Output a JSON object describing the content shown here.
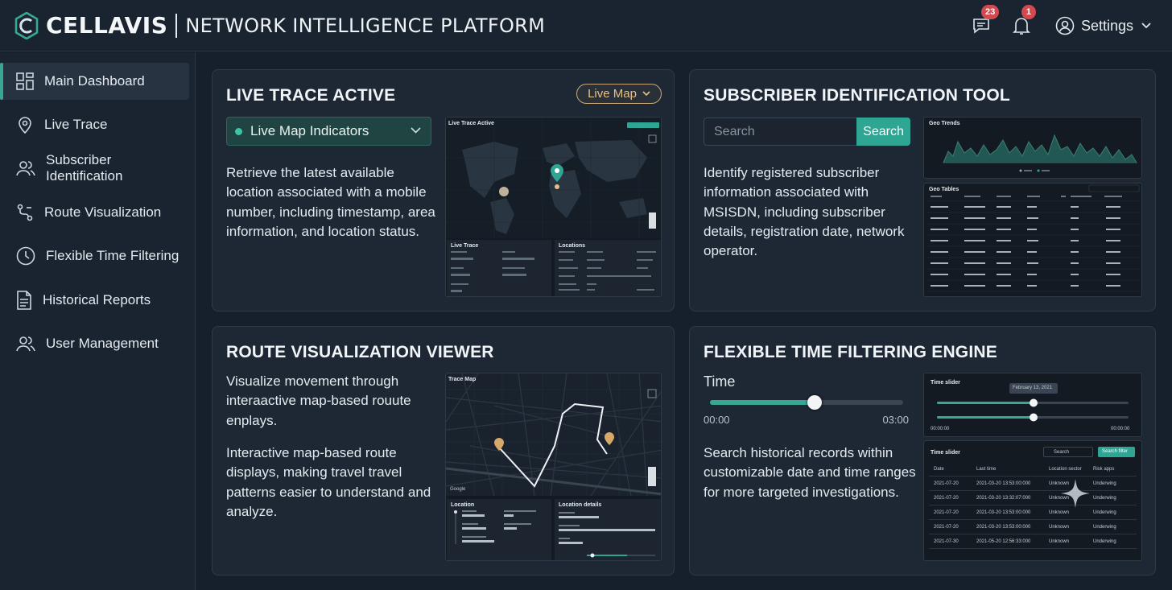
{
  "brand": {
    "name": "CELLAVIS",
    "subtitle": "NETWORK INTELLIGENCE PLATFORM"
  },
  "header": {
    "messages_count": "23",
    "alerts_count": "1",
    "settings_label": "Settings"
  },
  "sidebar": {
    "items": [
      {
        "label": "Main Dashboard",
        "icon": "grid-icon",
        "active": true
      },
      {
        "label": "Live Trace",
        "icon": "location-pin-icon"
      },
      {
        "label": "Subscriber Identification",
        "icon": "users-icon"
      },
      {
        "label": "Route Visualization",
        "icon": "route-icon"
      },
      {
        "label": "Flexible Time Filtering",
        "icon": "clock-icon"
      },
      {
        "label": "Historical Reports",
        "icon": "document-icon"
      },
      {
        "label": "User Management",
        "icon": "users-icon"
      }
    ]
  },
  "live_trace": {
    "title": "LIVE TRACE ACTIVE",
    "pill": "Live Map",
    "dropdown": "Live Map Indicators",
    "description": "Retrieve the latest available location associated with a mobile number, including timestamp, area information, and location status.",
    "preview": {
      "title": "Live Trace Active",
      "panel_left": "Live Trace",
      "panel_right": "Locations"
    }
  },
  "subscriber": {
    "title": "SUBSCRIBER IDENTIFICATION TOOL",
    "search_placeholder": "Search",
    "search_button": "Search",
    "description": "Identify registered subscriber information associated with MSISDN, including subscriber details, registration date, network operator.",
    "preview": {
      "chart_title": "Geo Trends",
      "table_title": "Geo Tables"
    }
  },
  "route": {
    "title": "ROUTE VISUALIZATION VIEWER",
    "description1": "Visualize movement through interaactive map-based rouute enplays.",
    "description2": "Interactive map-based route displays, making travel travel patterns easier to understand and analyze.",
    "preview": {
      "title": "Trace Map",
      "map_credit": "Google",
      "panel_left": "Location",
      "panel_right": "Location details"
    }
  },
  "time_filter": {
    "title": "FLEXIBLE TIME FILTERING ENGINE",
    "time_label": "Time",
    "slider_value": 0.54,
    "start": "00:00",
    "end": "03:00",
    "description": "Search historical records within customizable date and time ranges for more targeted investigations.",
    "preview": {
      "slider_title": "Time slider",
      "tooltip": "February 13, 2021",
      "start": "00:00:00",
      "end": "00:00:00",
      "table_title": "Time slider",
      "search": "Search",
      "button": "Search filter",
      "columns": [
        "Date",
        "Last time",
        "Location sector",
        "Risk apps"
      ],
      "rows": [
        [
          "2021-07-20",
          "2021-03-20 13:53:00:000",
          "Unknown",
          "Underwing"
        ],
        [
          "2021-07-20",
          "2021-03-20 13:32:07:000",
          "Unknown",
          "Underwing"
        ],
        [
          "2021-07-20",
          "2021-03-20 13:53:00:000",
          "Unknown",
          "Underwing"
        ],
        [
          "2021-07-20",
          "2021-03-20 13:53:00:000",
          "Unknown",
          "Underwing"
        ],
        [
          "2021-07-30",
          "2021-05-20 12:56:33:000",
          "Unknown",
          "Underwing"
        ]
      ]
    }
  },
  "colors": {
    "accent": "#2fa694",
    "background": "#16202c",
    "card": "#1e2835",
    "pill": "#e3c08a",
    "badge": "#d24a4f"
  }
}
